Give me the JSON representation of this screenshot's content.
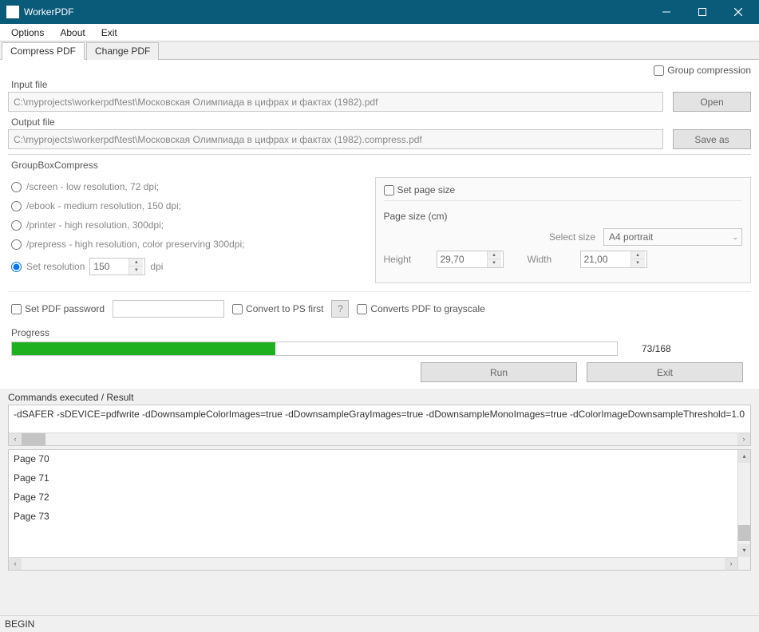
{
  "window": {
    "title": "WorkerPDF"
  },
  "menu": {
    "options": "Options",
    "about": "About",
    "exit": "Exit"
  },
  "tabs": {
    "compress": "Compress PDF",
    "change": "Change PDF"
  },
  "checks": {
    "group_compression": "Group compression"
  },
  "input": {
    "label": "Input file",
    "path": "C:\\myprojects\\workerpdf\\test\\Московская Олимпиада в цифрах и фактах (1982).pdf",
    "open": "Open"
  },
  "output": {
    "label": "Output file",
    "path": "C:\\myprojects\\workerpdf\\test\\Московская Олимпиада в цифрах и фактах (1982).compress.pdf",
    "saveas": "Save as"
  },
  "group": {
    "title": "GroupBoxCompress",
    "screen": "/screen - low resolution, 72 dpi;",
    "ebook": "/ebook - medium resolution, 150 dpi;",
    "printer": "/printer - high resolution, 300dpi;",
    "prepress": "/prepress - high resolution, color preserving 300dpi;",
    "setres": "Set resolution",
    "dpi_val": "150",
    "dpi_unit": "dpi"
  },
  "page": {
    "set_page_size": "Set page size",
    "page_size_cm": "Page size (cm)",
    "select_size": "Select size",
    "size_value": "A4 portrait",
    "height": "Height",
    "height_val": "29,70",
    "width": "Width",
    "width_val": "21,00"
  },
  "mid": {
    "set_pw": "Set PDF password",
    "convert_ps": "Convert to PS first",
    "help": "?",
    "grayscale": "Converts PDF to grayscale"
  },
  "progress": {
    "label": "Progress",
    "current": 73,
    "total": 168,
    "text": "73/168",
    "percent": 43.5
  },
  "buttons": {
    "run": "Run",
    "exit": "Exit"
  },
  "result": {
    "label": "Commands executed / Result",
    "cmd": "-dSAFER -sDEVICE=pdfwrite -dDownsampleColorImages=true -dDownsampleGrayImages=true -dDownsampleMonoImages=true -dColorImageDownsampleThreshold=1.0",
    "log": [
      "Page 70",
      "Page 71",
      "Page 72",
      "Page 73"
    ]
  },
  "status": "BEGIN"
}
